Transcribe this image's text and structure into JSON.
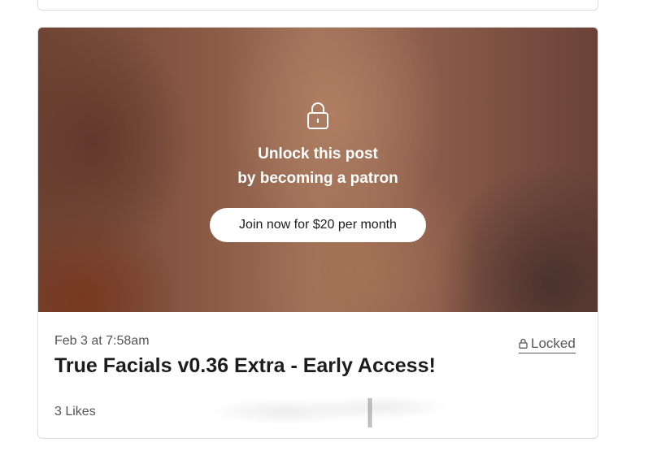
{
  "post": {
    "unlock_line1": "Unlock this post",
    "unlock_line2": "by becoming a patron",
    "join_button_label": "Join now for $20 per month",
    "date": "Feb 3 at 7:58am",
    "locked_label": "Locked",
    "title": "True Facials v0.36 Extra - Early Access!",
    "likes": "3 Likes",
    "lock_icon": "lock-icon"
  },
  "colors": {
    "overlay_text": "#ffffff",
    "title_text": "#1c1c1c",
    "muted_text": "#555555",
    "card_border": "#dcdcdc"
  }
}
